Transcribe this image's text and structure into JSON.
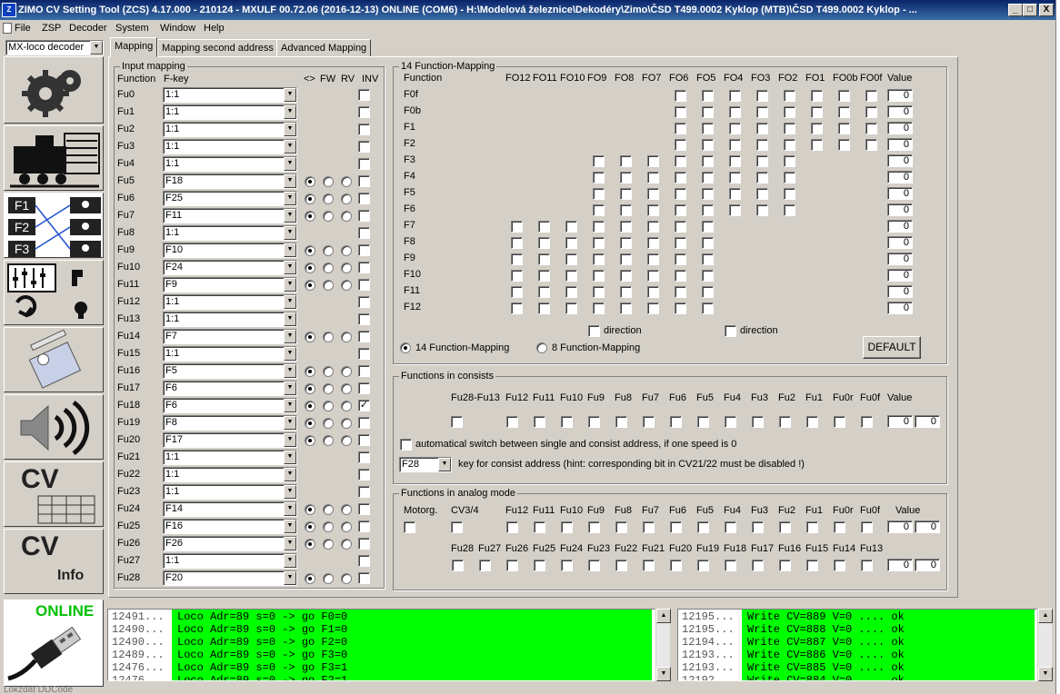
{
  "window": {
    "title": "ZIMO CV Setting Tool (ZCS) 4.17.000 - 210124 - MXULF 00.72.06 (2016-12-13)  ONLINE  (COM6) - H:\\Modelová železnice\\Dekodéry\\Zimo\\ČSD T499.0002 Kyklop (MTB)\\ČSD T499.0002 Kyklop - ...",
    "min": "_",
    "max": "□",
    "close": "X"
  },
  "menu": [
    "File",
    "ZSP",
    "Decoder",
    "System",
    "Window",
    "Help"
  ],
  "decoder_combo": "MX-loco decoder",
  "tabs": [
    "Mapping",
    "Mapping second address",
    "Advanced Mapping"
  ],
  "sidebar": {
    "online_label": "ONLINE",
    "cv_label": "CV",
    "cv_info_label": "CV",
    "info_label": "Info",
    "f_labels": [
      "F1",
      "F2",
      "F3"
    ]
  },
  "input_mapping": {
    "title": "Input mapping",
    "headers": {
      "function": "Function",
      "fkey": "F-key",
      "dir": "<>",
      "fw": "FW",
      "rv": "RV",
      "inv": "INV"
    },
    "rows": [
      {
        "fu": "Fu0",
        "key": "1:1",
        "radio": false,
        "sel": 0,
        "inv": false
      },
      {
        "fu": "Fu1",
        "key": "1:1",
        "radio": false,
        "sel": 0,
        "inv": false
      },
      {
        "fu": "Fu2",
        "key": "1:1",
        "radio": false,
        "sel": 0,
        "inv": false
      },
      {
        "fu": "Fu3",
        "key": "1:1",
        "radio": false,
        "sel": 0,
        "inv": false
      },
      {
        "fu": "Fu4",
        "key": "1:1",
        "radio": false,
        "sel": 0,
        "inv": false
      },
      {
        "fu": "Fu5",
        "key": "F18",
        "radio": true,
        "sel": 0,
        "inv": false
      },
      {
        "fu": "Fu6",
        "key": "F25",
        "radio": true,
        "sel": 0,
        "inv": false
      },
      {
        "fu": "Fu7",
        "key": "F11",
        "radio": true,
        "sel": 0,
        "inv": false
      },
      {
        "fu": "Fu8",
        "key": "1:1",
        "radio": false,
        "sel": 0,
        "inv": false
      },
      {
        "fu": "Fu9",
        "key": "F10",
        "radio": true,
        "sel": 0,
        "inv": false
      },
      {
        "fu": "Fu10",
        "key": "F24",
        "radio": true,
        "sel": 0,
        "inv": false
      },
      {
        "fu": "Fu11",
        "key": "F9",
        "radio": true,
        "sel": 0,
        "inv": false
      },
      {
        "fu": "Fu12",
        "key": "1:1",
        "radio": false,
        "sel": 0,
        "inv": false
      },
      {
        "fu": "Fu13",
        "key": "1:1",
        "radio": false,
        "sel": 0,
        "inv": false
      },
      {
        "fu": "Fu14",
        "key": "F7",
        "radio": true,
        "sel": 0,
        "inv": false
      },
      {
        "fu": "Fu15",
        "key": "1:1",
        "radio": false,
        "sel": 0,
        "inv": false
      },
      {
        "fu": "Fu16",
        "key": "F5",
        "radio": true,
        "sel": 0,
        "inv": false
      },
      {
        "fu": "Fu17",
        "key": "F6",
        "radio": true,
        "sel": 0,
        "inv": false
      },
      {
        "fu": "Fu18",
        "key": "F6",
        "radio": true,
        "sel": 0,
        "inv": true
      },
      {
        "fu": "Fu19",
        "key": "F8",
        "radio": true,
        "sel": 0,
        "inv": false
      },
      {
        "fu": "Fu20",
        "key": "F17",
        "radio": true,
        "sel": 0,
        "inv": false
      },
      {
        "fu": "Fu21",
        "key": "1:1",
        "radio": false,
        "sel": 0,
        "inv": false
      },
      {
        "fu": "Fu22",
        "key": "1:1",
        "radio": false,
        "sel": 0,
        "inv": false
      },
      {
        "fu": "Fu23",
        "key": "1:1",
        "radio": false,
        "sel": 0,
        "inv": false
      },
      {
        "fu": "Fu24",
        "key": "F14",
        "radio": true,
        "sel": 0,
        "inv": false
      },
      {
        "fu": "Fu25",
        "key": "F16",
        "radio": true,
        "sel": 0,
        "inv": false
      },
      {
        "fu": "Fu26",
        "key": "F26",
        "radio": true,
        "sel": 0,
        "inv": false
      },
      {
        "fu": "Fu27",
        "key": "1:1",
        "radio": false,
        "sel": 0,
        "inv": false
      },
      {
        "fu": "Fu28",
        "key": "F20",
        "radio": true,
        "sel": 0,
        "inv": false
      }
    ]
  },
  "fm14": {
    "title": "14 Function-Mapping",
    "function_header": "Function",
    "outputs": [
      "FO12",
      "FO11",
      "FO10",
      "FO9",
      "FO8",
      "FO7",
      "FO6",
      "FO5",
      "FO4",
      "FO3",
      "FO2",
      "FO1",
      "FO0b",
      "FO0f"
    ],
    "value_header": "Value",
    "rows": [
      {
        "name": "F0f",
        "from": 6,
        "value": "0"
      },
      {
        "name": "F0b",
        "from": 6,
        "value": "0"
      },
      {
        "name": "F1",
        "from": 6,
        "value": "0"
      },
      {
        "name": "F2",
        "from": 6,
        "value": "0"
      },
      {
        "name": "F3",
        "from": 3,
        "to": 10,
        "value": "0"
      },
      {
        "name": "F4",
        "from": 3,
        "to": 10,
        "value": "0"
      },
      {
        "name": "F5",
        "from": 3,
        "to": 10,
        "value": "0"
      },
      {
        "name": "F6",
        "from": 3,
        "to": 10,
        "value": "0"
      },
      {
        "name": "F7",
        "from": 0,
        "to": 7,
        "value": "0"
      },
      {
        "name": "F8",
        "from": 0,
        "to": 7,
        "value": "0"
      },
      {
        "name": "F9",
        "from": 0,
        "to": 7,
        "value": "0"
      },
      {
        "name": "F10",
        "from": 0,
        "to": 7,
        "value": "0"
      },
      {
        "name": "F11",
        "from": 0,
        "to": 7,
        "value": "0"
      },
      {
        "name": "F12",
        "from": 0,
        "to": 7,
        "value": "0"
      }
    ],
    "direction1": "direction",
    "direction2": "direction",
    "mode14": "14 Function-Mapping",
    "mode8": "8 Function-Mapping",
    "default_btn": "DEFAULT"
  },
  "consists": {
    "title": "Functions in consists",
    "headers": [
      "Fu28-Fu13",
      "Fu12",
      "Fu11",
      "Fu10",
      "Fu9",
      "Fu8",
      "Fu7",
      "Fu6",
      "Fu5",
      "Fu4",
      "Fu3",
      "Fu2",
      "Fu1",
      "Fu0r",
      "Fu0f"
    ],
    "value_header": "Value",
    "values": [
      "0",
      "0"
    ],
    "auto_switch": "automatical switch between single and consist address, if one speed is 0",
    "key_combo": "F28",
    "key_hint": "key for consist address (hint: corresponding bit in CV21/22 must be disabled !)"
  },
  "analog": {
    "title": "Functions in analog mode",
    "motor": "Motorg.",
    "cv34": "CV3/4",
    "row1": [
      "Fu12",
      "Fu11",
      "Fu10",
      "Fu9",
      "Fu8",
      "Fu7",
      "Fu6",
      "Fu5",
      "Fu4",
      "Fu3",
      "Fu2",
      "Fu1",
      "Fu0r",
      "Fu0f"
    ],
    "row2": [
      "Fu28",
      "Fu27",
      "Fu26",
      "Fu25",
      "Fu24",
      "Fu23",
      "Fu22",
      "Fu21",
      "Fu20",
      "Fu19",
      "Fu18",
      "Fu17",
      "Fu16",
      "Fu15",
      "Fu14",
      "Fu13"
    ],
    "value_header": "Value",
    "values1": [
      "0",
      "0"
    ],
    "values2": [
      "0",
      "0"
    ]
  },
  "log_left": [
    {
      "n": "12491...",
      "t": "Loco Adr=89 s=0 -> go F0=0"
    },
    {
      "n": "12490...",
      "t": "Loco Adr=89 s=0 -> go F1=0"
    },
    {
      "n": "12490...",
      "t": "Loco Adr=89 s=0 -> go F2=0"
    },
    {
      "n": "12489...",
      "t": "Loco Adr=89 s=0 -> go F3=0"
    },
    {
      "n": "12476...",
      "t": "Loco Adr=89 s=0 -> go F3=1"
    },
    {
      "n": "12476...",
      "t": "Loco Adr=89 s=0 -> go F2=1"
    }
  ],
  "log_right": [
    {
      "n": "12195...",
      "t": "Write CV=889 V=0 .... ok"
    },
    {
      "n": "12195...",
      "t": "Write CV=888 V=0 .... ok"
    },
    {
      "n": "12194...",
      "t": "Write CV=887 V=0 .... ok"
    },
    {
      "n": "12193...",
      "t": "Write CV=886 V=0 .... ok"
    },
    {
      "n": "12193...",
      "t": "Write CV=885 V=0 .... ok"
    },
    {
      "n": "12192...",
      "t": "Write CV=884 V=0 .... ok"
    }
  ],
  "status_fragment": "Lokzdat DDCode",
  "colors": {
    "accent": "#0a246a",
    "online": "#00c000",
    "log_bg": "#00ff00",
    "face": "#d4d0c8"
  }
}
